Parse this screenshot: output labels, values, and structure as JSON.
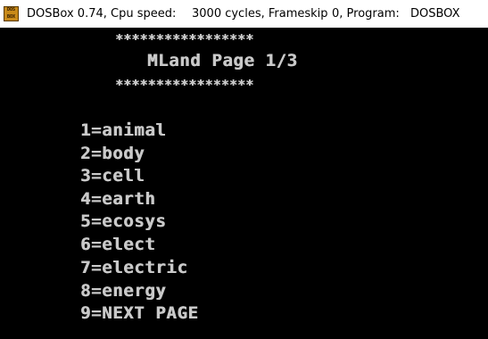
{
  "window": {
    "icon_name": "dosbox-icon",
    "icon_text_top": "DOS",
    "icon_text_bottom": "BOX",
    "title_app": "DOSBox 0.74, Cpu speed:",
    "title_cycles": "3000 cycles, Frameskip",
    "title_frameskip": "0, Program:",
    "title_program": "DOSBOX"
  },
  "screen": {
    "stars_top": "*****************",
    "header": "MLand Page 1/3",
    "stars_bottom": "*****************",
    "menu_items": [
      "1=animal",
      "2=body",
      "3=cell",
      "4=earth",
      "5=ecosys",
      "6=elect",
      "7=electric",
      "8=energy",
      "9=NEXT PAGE"
    ]
  },
  "colors": {
    "background": "#000000",
    "text": "#c9c9c9",
    "titlebar": "#ffffff"
  }
}
